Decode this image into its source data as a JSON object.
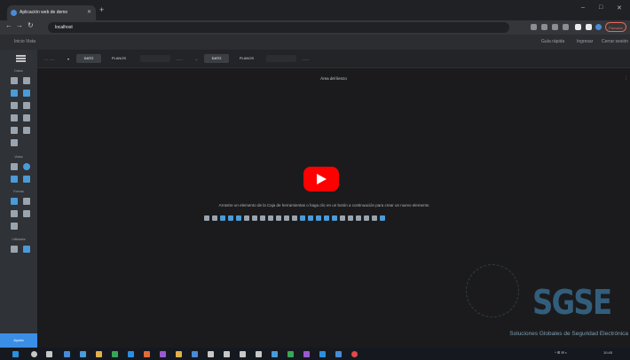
{
  "browser": {
    "tab_title": "Aplicación web de demo",
    "tab_close": "✕",
    "new_tab": "+",
    "address": "localhost",
    "profile_label": "Pausado"
  },
  "window_controls": [
    "–",
    "□",
    "✕"
  ],
  "app_header": {
    "left_text": "Inicio   Vista",
    "right_links": [
      "Guía rápida",
      "Ingresar",
      "Cerrar sesión"
    ]
  },
  "sidebar": {
    "sections": [
      "Datos",
      "Vistas",
      "Formas",
      "Utilidades"
    ],
    "bottom_label": "Ayuda"
  },
  "toolbar": {
    "menu_icon": "menu-icon",
    "left_text": "--- --:--",
    "left_marker": "▾",
    "button1": "DATO",
    "button2": "PLANOS",
    "mid_text": "------",
    "mid_marker": "--",
    "button3": "DATO",
    "button4": "PLANOS",
    "right_text": "------"
  },
  "canvas": {
    "title": "Área del lienzo",
    "menu": "⋮",
    "hint": "Arrastre un elemento de la Caja de herramientas o haga clic en un botón a continuación para crear un nuevo elemento",
    "tool_colors": [
      "#9aa4ae",
      "#9aa4ae",
      "#4a9bd8",
      "#4a9bd8",
      "#4a9bd8",
      "#9aa4ae",
      "#9aa4ae",
      "#9aa4ae",
      "#9aa4ae",
      "#9aa4ae",
      "#9aa4ae",
      "#9aa4ae",
      "#4a9bd8",
      "#4a9bd8",
      "#4a9bd8",
      "#4a9bd8",
      "#4a9bd8",
      "#9aa4ae",
      "#9aa4ae",
      "#9aa4ae",
      "#9aa4ae",
      "#9aa4ae",
      "#4a9bd8"
    ]
  },
  "video": {
    "play_icon": "play-icon",
    "color": "#ff0000"
  },
  "logo": {
    "text": "SGSE",
    "tagline": "Soluciones Globales de Seguridad Electrónica"
  },
  "taskbar": {
    "clock": "10:45",
    "tray": "^ ⊞ ✉ ◐"
  }
}
